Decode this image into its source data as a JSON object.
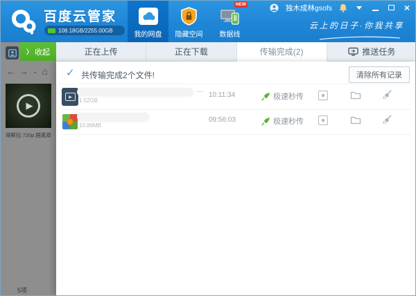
{
  "window": {
    "app_title": "百度云管家",
    "storage_text": "108.18GB/2255.00GB",
    "username": "独木成林gsofs",
    "slogan": "云上的日子·你我共享"
  },
  "header_nav": {
    "my_drive": "我的网盘",
    "hidden_space": "隐藏空间",
    "data_line": "数据线",
    "new_badge": "NEW"
  },
  "transfer_toolbar": {
    "collapse_chevron": "〉",
    "collapse_label": "收起"
  },
  "tabs": {
    "uploading": "正在上传",
    "downloading": "正在下载",
    "completed": "传输完成(2)",
    "push": "推送任务"
  },
  "panel": {
    "summary": "共传输完成2个文件!",
    "clear_button": "清除所有记录",
    "rows": [
      {
        "size": "1.52GB",
        "time": "10:11:34",
        "mode": "极速秒传",
        "ellipsis": "…"
      },
      {
        "size": "10.86MB",
        "time": "09:56:03",
        "mode": "极速秒传",
        "ellipsis": ""
      }
    ]
  },
  "sidebar": {
    "back": "←",
    "forward": "→",
    "caret": "⌄",
    "home": "⌂",
    "play": "▶",
    "caption": "哥斯拉.720p.国英双",
    "count": "5项"
  },
  "glyphs": {
    "check": "✓",
    "close": "×"
  }
}
